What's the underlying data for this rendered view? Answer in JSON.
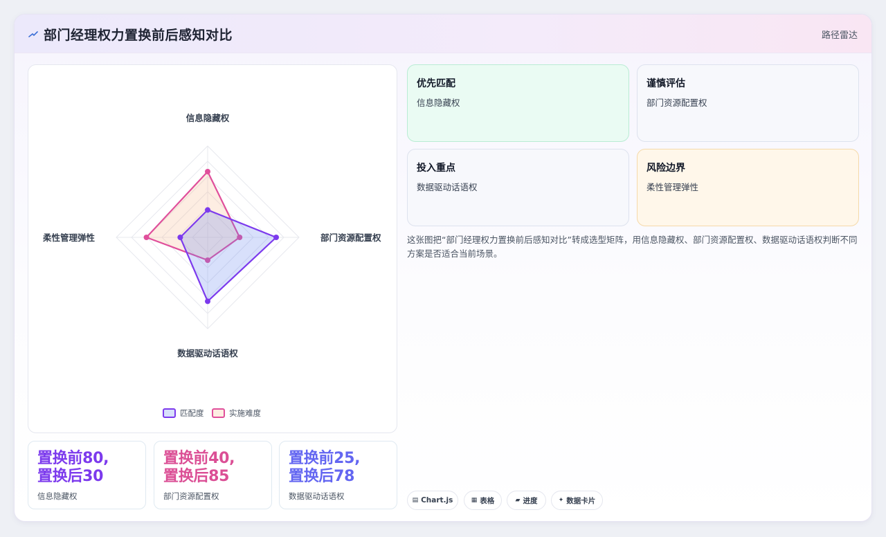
{
  "header": {
    "title": "部门经理权力置换前后感知对比",
    "action": "路径雷达"
  },
  "chart_data": {
    "type": "radar",
    "axes": [
      "信息隐藏权",
      "部门资源配置权",
      "数据驱动话语权",
      "柔性管理弹性"
    ],
    "range": [
      0,
      100
    ],
    "series": [
      {
        "name": "匹配度",
        "values": [
          30,
          75,
          70,
          30
        ],
        "color": "#7c3aed",
        "fill": "rgba(99,130,240,0.25)"
      },
      {
        "name": "实施难度",
        "values": [
          72,
          35,
          25,
          67
        ],
        "color": "#e04f9b",
        "fill": "rgba(247,190,150,0.28)"
      }
    ],
    "legend": "bottom",
    "grid": true
  },
  "stats": [
    {
      "value": "置换前80,\n置换后30",
      "label": "信息隐藏权",
      "color": "#7c3aed"
    },
    {
      "value": "置换前40,\n置换后85",
      "label": "部门资源配置权",
      "color": "#db4f95"
    },
    {
      "value": "置换前25,\n置换后78",
      "label": "数据驱动话语权",
      "color": "#6366f1"
    }
  ],
  "recommendations": [
    {
      "title": "优先匹配",
      "value": "信息隐藏权"
    },
    {
      "title": "谨慎评估",
      "value": "部门资源配置权"
    },
    {
      "title": "投入重点",
      "value": "数据驱动话语权"
    },
    {
      "title": "风险边界",
      "value": "柔性管理弹性"
    }
  ],
  "description": "这张图把“部门经理权力置换前后感知对比”转成选型矩阵，用信息隐藏权、部门资源配置权、数据驱动话语权判断不同方案是否适合当前场景。",
  "chips": [
    {
      "icon": "▤",
      "label": "Chart.js"
    },
    {
      "icon": "▦",
      "label": "表格"
    },
    {
      "icon": "▰",
      "label": "进度"
    },
    {
      "icon": "✦",
      "label": "数据卡片"
    }
  ]
}
